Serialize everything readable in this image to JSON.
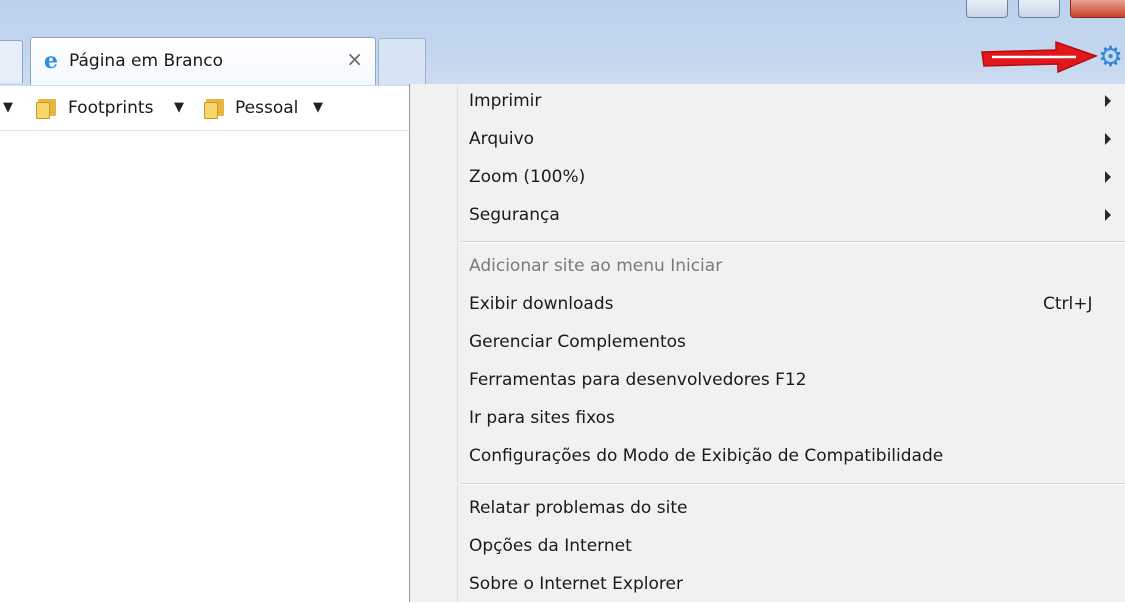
{
  "tab": {
    "title": "Página em Branco",
    "close_glyph": "×"
  },
  "favorites": [
    {
      "label": "Footprints"
    },
    {
      "label": "Pessoal"
    }
  ],
  "menu": {
    "group1": [
      {
        "label": "Imprimir"
      },
      {
        "label": "Arquivo"
      },
      {
        "label": "Zoom (100%)"
      },
      {
        "label": "Segurança"
      }
    ],
    "group2": [
      {
        "label": "Adicionar site ao menu Iniciar"
      },
      {
        "label": "Exibir downloads",
        "shortcut": "Ctrl+J"
      },
      {
        "label": "Gerenciar Complementos"
      },
      {
        "label": "Ferramentas para desenvolvedores F12"
      },
      {
        "label": "Ir para sites fixos"
      },
      {
        "label": "Configurações do Modo de Exibição de Compatibilidade"
      }
    ],
    "group3": [
      {
        "label": "Relatar problemas do site"
      },
      {
        "label": "Opções da Internet"
      },
      {
        "label": "Sobre o Internet Explorer"
      }
    ]
  },
  "colors": {
    "frame": "#c3d6ee",
    "gear": "#2f86d6",
    "annotation_arrow": "#e3161c",
    "menu_bg": "#f1f1f1"
  },
  "icons": {
    "tab": "ie-logo-icon",
    "favorites": "folder-icon",
    "tools": "gear-icon",
    "annotation": "red-arrow-annotation"
  }
}
